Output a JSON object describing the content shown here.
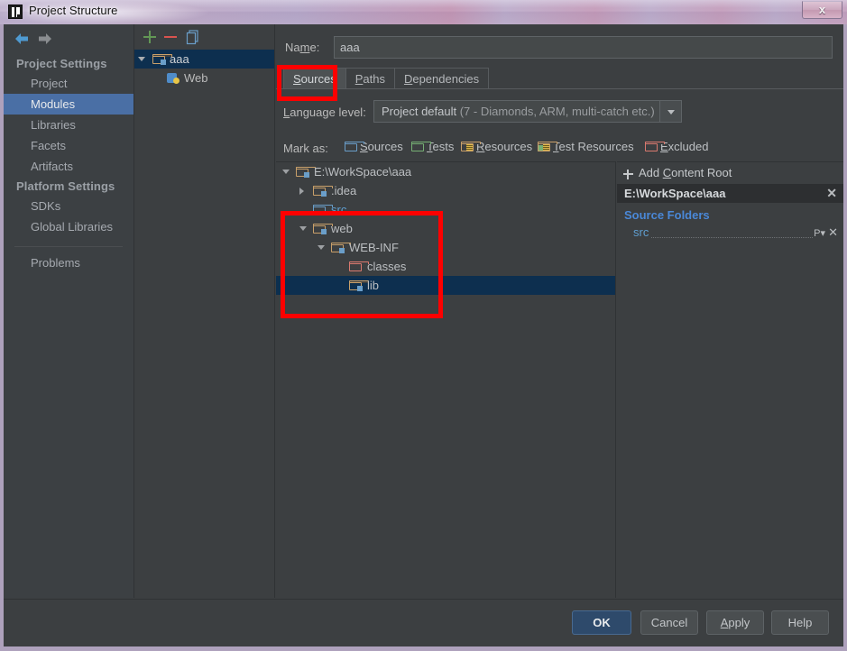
{
  "window": {
    "title": "Project Structure",
    "app_icon": "intellij-idea-icon",
    "close_label": "x"
  },
  "sidebar": {
    "back_icon": "arrow-left-icon",
    "forward_icon": "arrow-right-icon",
    "groups": [
      {
        "title": "Project Settings",
        "items": [
          {
            "label": "Project",
            "selected": false
          },
          {
            "label": "Modules",
            "selected": true
          },
          {
            "label": "Libraries",
            "selected": false
          },
          {
            "label": "Facets",
            "selected": false
          },
          {
            "label": "Artifacts",
            "selected": false
          }
        ]
      },
      {
        "title": "Platform Settings",
        "items": [
          {
            "label": "SDKs",
            "selected": false
          },
          {
            "label": "Global Libraries",
            "selected": false
          }
        ]
      }
    ],
    "footer_item": "Problems"
  },
  "modules_panel": {
    "toolbar": {
      "add_icon": "plus-icon",
      "remove_icon": "minus-icon",
      "copy_icon": "copy-icon"
    },
    "tree": [
      {
        "label": "aaa",
        "icon": "module-folder-icon",
        "indent": 0,
        "twisty": "open",
        "selected": true
      },
      {
        "label": "Web",
        "icon": "web-facet-icon",
        "indent": 1,
        "twisty": "none",
        "selected": false
      }
    ]
  },
  "main": {
    "name_label_pre": "Na",
    "name_label_accel": "m",
    "name_label_post": "e:",
    "name_value": "aaa",
    "tabs": [
      {
        "label_pre": "",
        "accel": "S",
        "label_post": "ources",
        "active": true
      },
      {
        "label_pre": "",
        "accel": "P",
        "label_post": "aths",
        "active": false
      },
      {
        "label_pre": "",
        "accel": "D",
        "label_post": "ependencies",
        "active": false
      }
    ],
    "language_level": {
      "label_accel": "L",
      "label_rest": "anguage level:",
      "value_main": "Project default ",
      "value_dim": "(7 - Diamonds, ARM, multi-catch etc.)",
      "dropdown_icon": "chevron-down-icon"
    },
    "mark_as": {
      "label": "Mark as:",
      "buttons": [
        {
          "accel": "S",
          "rest": "ources",
          "icon": "folder-blue-icon",
          "kind": "blue"
        },
        {
          "accel": "T",
          "rest": "ests",
          "icon": "folder-green-icon",
          "kind": "green"
        },
        {
          "accel": "R",
          "rest": "esources",
          "icon": "folder-resources-icon",
          "kind": "res"
        },
        {
          "accel": "T",
          "rest": "est Resources",
          "icon": "folder-test-resources-icon",
          "kind": "testres"
        },
        {
          "accel": "E",
          "rest": "xcluded",
          "icon": "folder-red-icon",
          "kind": "red"
        }
      ]
    },
    "content_tree": [
      {
        "label": "E:\\WorkSpace\\aaa",
        "indent": 0,
        "twisty": "open",
        "kind": "mod",
        "selected": false
      },
      {
        "label": ".idea",
        "indent": 1,
        "twisty": "closed",
        "kind": "mod",
        "selected": false
      },
      {
        "label": "src",
        "indent": 1,
        "twisty": "none",
        "kind": "blue",
        "selected": false,
        "source": true
      },
      {
        "label": "web",
        "indent": 1,
        "twisty": "open",
        "kind": "mod",
        "selected": false
      },
      {
        "label": "WEB-INF",
        "indent": 2,
        "twisty": "open",
        "kind": "mod",
        "selected": false
      },
      {
        "label": "classes",
        "indent": 3,
        "twisty": "none",
        "kind": "red",
        "selected": false
      },
      {
        "label": "lib",
        "indent": 3,
        "twisty": "none",
        "kind": "mod",
        "selected": true
      }
    ]
  },
  "right_panel": {
    "add_content_root": {
      "pre": "Add ",
      "accel": "C",
      "post": "ontent Root",
      "icon": "plus-icon"
    },
    "content_root": {
      "path": "E:\\WorkSpace\\aaa",
      "remove_icon": "close-x-icon"
    },
    "source_folders_header": "Source Folders",
    "source_folders": [
      {
        "name": "src",
        "package_prefix_icon": "package-prefix-icon",
        "remove_icon": "close-x-icon"
      }
    ]
  },
  "footer": {
    "buttons": [
      {
        "id": "ok",
        "pre": "",
        "accel": "",
        "post": "OK",
        "primary": true
      },
      {
        "id": "cancel",
        "pre": "",
        "accel": "",
        "post": "Cancel",
        "primary": false
      },
      {
        "id": "apply",
        "pre": "",
        "accel": "A",
        "post": "pply",
        "primary": false
      },
      {
        "id": "help",
        "pre": "",
        "accel": "",
        "post": "Help",
        "primary": false
      }
    ]
  },
  "annotations": {
    "sources_tab_highlight": "red-box-sources-tab",
    "web_tree_highlight": "red-box-web-folder"
  },
  "colors": {
    "accent_selection": "#4a6fa5",
    "tree_selection": "#0d2f4f",
    "source_folder_blue": "#5f9ecf",
    "source_folders_header": "#4a88d8",
    "annotation_red": "#fe0000",
    "panel_bg": "#3c3f41",
    "primary_button": "#2e4a6b"
  }
}
